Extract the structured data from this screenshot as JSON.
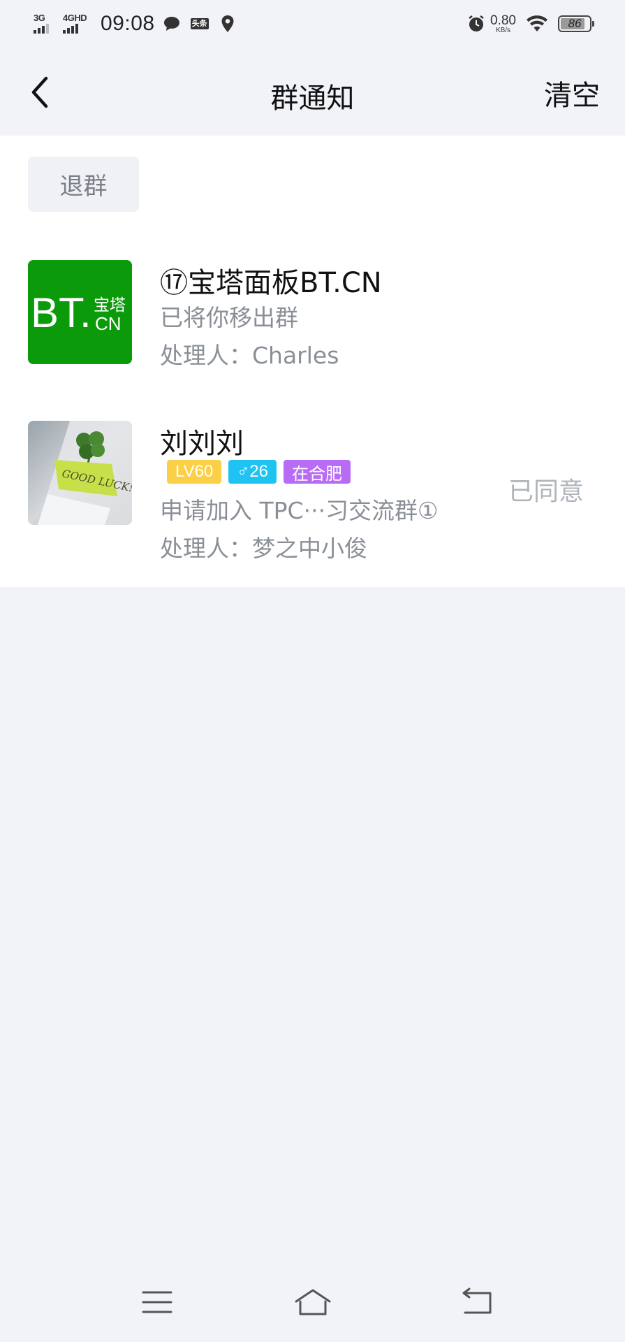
{
  "status_bar": {
    "network_1": "3G",
    "network_2": "4GHD",
    "time": "09:08",
    "toutiao_badge": "头条",
    "speed_value": "0.80",
    "speed_unit": "KB/s",
    "battery_level": 86,
    "battery_text": "86",
    "icons": [
      "signal-3g-icon",
      "signal-4g-icon",
      "message-bubble-icon",
      "toutiao-icon",
      "location-icon",
      "alarm-icon",
      "wifi-icon",
      "battery-icon"
    ]
  },
  "header": {
    "back_icon": "back-arrow-icon",
    "title": "群通知",
    "clear_label": "清空"
  },
  "filter": {
    "chip_label": "退群"
  },
  "notifications": [
    {
      "avatar_text_main": "BT.",
      "avatar_text_top": "宝塔",
      "avatar_text_bottom": "CN",
      "avatar_color": "#0a9a0a",
      "name": "⑰宝塔面板BT.CN",
      "message": "已将你移出群",
      "handler": "处理人：Charles"
    },
    {
      "avatar_caption": "GOOD LUCK!",
      "name": "刘刘刘",
      "tags": [
        {
          "label": "LV60",
          "color": "#fbd046"
        },
        {
          "label": "♂26",
          "color": "#1fc3f3"
        },
        {
          "label": "在合肥",
          "color": "#b86cf5"
        }
      ],
      "message": "申请加入 TPC···习交流群①",
      "handler": "处理人：梦之中小俊",
      "status": "已同意"
    }
  ],
  "bottom_nav": {
    "icons": [
      "menu-icon",
      "home-icon",
      "back-icon"
    ]
  }
}
